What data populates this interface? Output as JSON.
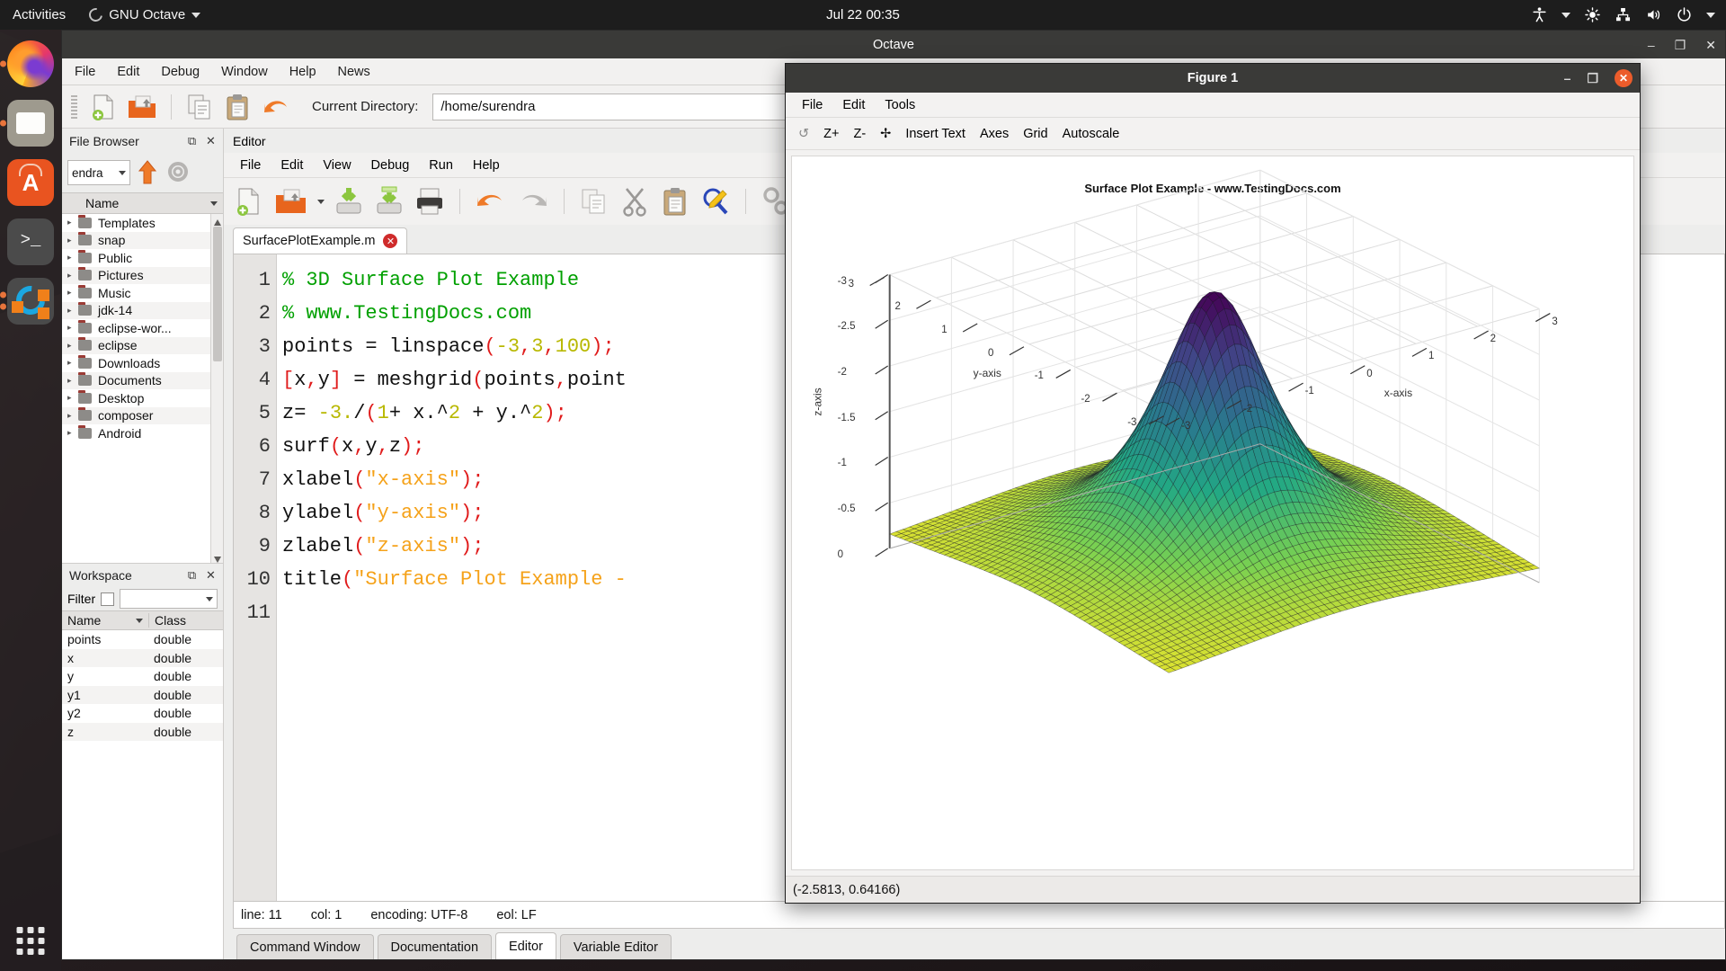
{
  "topbar": {
    "activities": "Activities",
    "app_name": "GNU Octave",
    "clock": "Jul 22  00:35",
    "tray_icons": [
      "accessibility-icon",
      "chevron-down-icon",
      "brightness-icon",
      "network-icon",
      "volume-icon",
      "power-icon",
      "chevron-down-icon"
    ]
  },
  "dock": {
    "items": [
      {
        "name": "firefox",
        "running": true
      },
      {
        "name": "files",
        "running": true
      },
      {
        "name": "ubuntu-software",
        "running": false
      },
      {
        "name": "terminal",
        "running": false
      },
      {
        "name": "gnu-octave",
        "running": true
      }
    ],
    "show_apps": "show-applications"
  },
  "octave_window": {
    "title": "Octave",
    "window_buttons": {
      "minimize": "–",
      "maximize": "❐",
      "close": "✕"
    },
    "menus": [
      "File",
      "Edit",
      "Debug",
      "Window",
      "Help",
      "News"
    ],
    "toolbar_icons": [
      "new-script-icon",
      "open-file-icon",
      "copy-icon",
      "paste-icon",
      "undo-icon"
    ],
    "current_directory_label": "Current Directory:",
    "current_directory_value": "/home/surendra"
  },
  "file_browser": {
    "title": "File Browser",
    "undock_icon": "undock-icon",
    "close_icon": "close-icon",
    "path_combo_value": "endra",
    "up_icon": "arrow-up-icon",
    "settings_icon": "gear-icon",
    "column_header": "Name",
    "items": [
      "Android",
      "composer",
      "Desktop",
      "Documents",
      "Downloads",
      "eclipse",
      "eclipse-wor...",
      "jdk-14",
      "Music",
      "Pictures",
      "Public",
      "snap",
      "Templates"
    ]
  },
  "workspace": {
    "title": "Workspace",
    "undock_icon": "undock-icon",
    "close_icon": "close-icon",
    "filter_label": "Filter",
    "filter_value": "",
    "columns": [
      "Name",
      "Class"
    ],
    "rows": [
      {
        "name": "points",
        "class": "double"
      },
      {
        "name": "x",
        "class": "double"
      },
      {
        "name": "y",
        "class": "double"
      },
      {
        "name": "y1",
        "class": "double"
      },
      {
        "name": "y2",
        "class": "double"
      },
      {
        "name": "z",
        "class": "double"
      }
    ]
  },
  "editor": {
    "title": "Editor",
    "undock_icon": "undock-icon",
    "close_icon": "close-icon",
    "menus": [
      "File",
      "Edit",
      "View",
      "Debug",
      "Run",
      "Help"
    ],
    "toolbar_icons": [
      "new-script-icon",
      "open-file-icon",
      "save-icon",
      "save-as-icon",
      "print-icon",
      "undo-icon",
      "redo-icon",
      "copy-icon",
      "cut-icon",
      "paste-icon",
      "find-replace-icon",
      "preferences-icon"
    ],
    "tab": {
      "label": "SurfacePlotExample.m",
      "close_icon": "close-icon"
    },
    "line_numbers": [
      "1",
      "2",
      "3",
      "4",
      "5",
      "6",
      "7",
      "8",
      "9",
      "10",
      "11"
    ],
    "code_lines": [
      "% 3D Surface Plot Example",
      "% www.TestingDocs.com",
      "points = linspace(-3,3,100);",
      "[x,y] = meshgrid(points,point",
      "z= -3./(1+ x.^2 + y.^2);",
      "surf(x,y,z);",
      "xlabel(\"x-axis\");",
      "ylabel(\"y-axis\");",
      "zlabel(\"z-axis\");",
      "title(\"Surface Plot Example -",
      ""
    ],
    "status": {
      "line": "line: 11",
      "col": "col: 1",
      "encoding": "encoding: UTF-8",
      "eol": "eol: LF"
    }
  },
  "bottom_tabs": [
    {
      "label": "Command Window",
      "active": false
    },
    {
      "label": "Documentation",
      "active": false
    },
    {
      "label": "Editor",
      "active": true
    },
    {
      "label": "Variable Editor",
      "active": false
    }
  ],
  "figure_window": {
    "title": "Figure 1",
    "window_buttons": {
      "minimize": "–",
      "maximize": "❐",
      "close": "✕"
    },
    "menus": [
      "File",
      "Edit",
      "Tools"
    ],
    "toolbar": [
      {
        "name": "rotate-icon",
        "label": "↺"
      },
      {
        "name": "zoom-in-button",
        "label": "Z+"
      },
      {
        "name": "zoom-out-button",
        "label": "Z-"
      },
      {
        "name": "pan-icon",
        "label": "✢"
      },
      {
        "name": "insert-text-button",
        "label": "Insert Text"
      },
      {
        "name": "axes-button",
        "label": "Axes"
      },
      {
        "name": "grid-button",
        "label": "Grid"
      },
      {
        "name": "autoscale-button",
        "label": "Autoscale"
      }
    ],
    "status_coordinates": "(-2.5813, 0.64166)"
  },
  "chart_data": {
    "type": "surface",
    "title": "Surface Plot Example - www.TestingDocs.com",
    "xlabel": "x-axis",
    "ylabel": "y-axis",
    "zlabel": "z-axis",
    "expression": "z = -3./(1 + x.^2 + y.^2)",
    "grid_points": 100,
    "xlim": [
      -3,
      3
    ],
    "ylim": [
      -3,
      3
    ],
    "zlim": [
      -3,
      0
    ],
    "xticks": [
      "-3",
      "-2",
      "-1",
      "0",
      "1",
      "2",
      "3"
    ],
    "yticks": [
      "3",
      "2",
      "1",
      "0",
      "-1",
      "-2",
      "-3"
    ],
    "zticks": [
      "0",
      "-0.5",
      "-1",
      "-1.5",
      "-2",
      "-2.5",
      "-3"
    ],
    "colormap": "viridis",
    "colormap_stops": [
      "#440154",
      "#414487",
      "#2a788e",
      "#22a884",
      "#7ad151",
      "#fde725"
    ],
    "grid": true,
    "legend": null
  }
}
